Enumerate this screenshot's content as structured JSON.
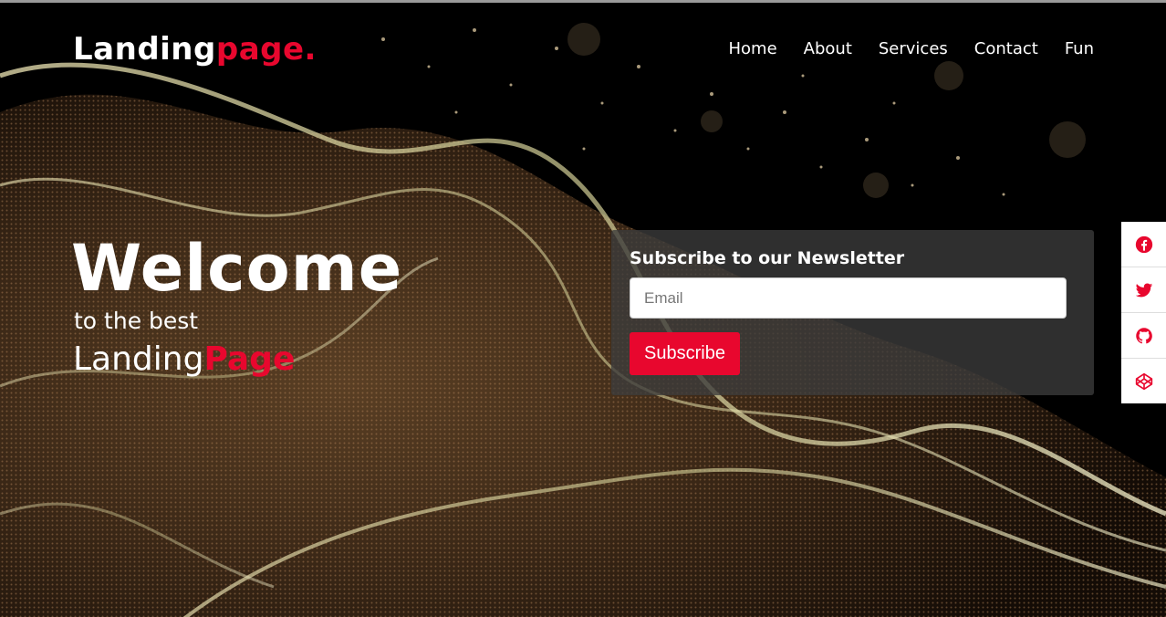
{
  "header": {
    "logo_main": "Landing",
    "logo_accent": "page.",
    "nav": [
      {
        "label": "Home"
      },
      {
        "label": "About"
      },
      {
        "label": "Services"
      },
      {
        "label": "Contact"
      },
      {
        "label": "Fun"
      }
    ]
  },
  "hero": {
    "title": "Welcome",
    "subtitle": "to the best",
    "brand_main": "Landing",
    "brand_accent": "Page"
  },
  "newsletter": {
    "title": "Subscribe to our Newsletter",
    "email_placeholder": "Email",
    "email_value": "",
    "button_label": "Subscribe"
  },
  "social": [
    {
      "icon": "facebook-icon"
    },
    {
      "icon": "twitter-icon"
    },
    {
      "icon": "github-icon"
    },
    {
      "icon": "codepen-icon"
    }
  ],
  "colors": {
    "accent": "#e8072e",
    "text": "#ffffff",
    "panel": "#3c3c3c"
  }
}
